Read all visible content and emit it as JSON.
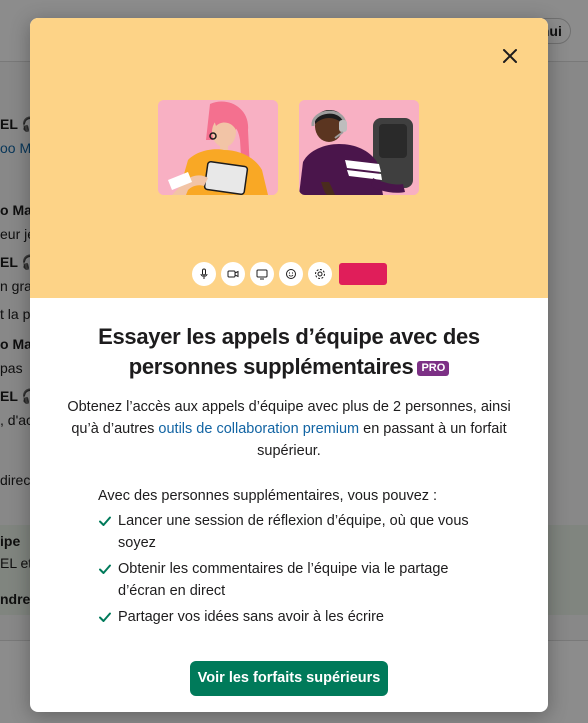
{
  "background": {
    "date_pill": "d'hui",
    "lines": [
      "EL 🎧",
      "oo M",
      "o Ma",
      "eur je",
      "EL 🎧",
      "n gra",
      "t la p",
      "o Ma",
      " pas",
      "EL 🎧",
      ", d'ac",
      "direct",
      "ipe",
      "EL et",
      "ndre"
    ]
  },
  "modal": {
    "close_icon": "close-icon",
    "title_line1": "Essayer les appels d’équipe avec des",
    "title_line2": "personnes supplémentaires",
    "badge": "PRO",
    "description_before": "Obtenez l’accès aux appels d’équipe avec plus de 2 personnes, ainsi qu’à d’autres ",
    "description_link": "outils de collaboration premium",
    "description_after": " en passant à un forfait supérieur.",
    "features_intro": "Avec des personnes supplémentaires, vous pouvez :",
    "features": [
      "Lancer une session de réflexion d’équipe, où que vous soyez",
      "Obtenir les commentaires de l’équipe via le partage d’écran en direct",
      "Partager vos idées sans avoir à les écrire"
    ],
    "cta_label": "Voir les forfaits supérieurs"
  },
  "colors": {
    "hero_bg": "#fdd387",
    "tile_bg": "#f8b0c3",
    "hangup": "#e01e5a",
    "cta": "#007a5a",
    "badge": "#7c3085",
    "link": "#1264a3"
  },
  "call_controls": [
    "microphone-icon",
    "video-icon",
    "screen-share-icon",
    "emoji-icon",
    "settings-icon",
    "hangup-button"
  ]
}
